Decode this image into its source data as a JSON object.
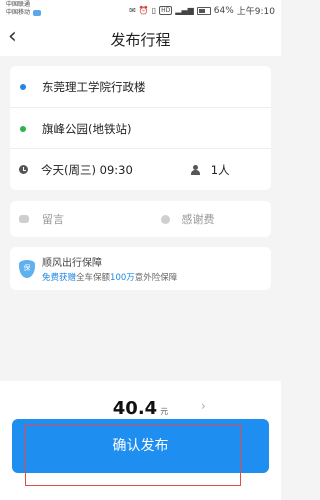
{
  "status_bar": {
    "carrier1": "中国联通",
    "carrier2": "中国移动",
    "battery": "64%",
    "time": "上午9:10",
    "hd": "HD"
  },
  "nav": {
    "back_icon": "chevron-left-icon",
    "title": "发布行程"
  },
  "route": {
    "origin": {
      "text": "东莞理工学院行政楼",
      "dot_color": "#1e88e5"
    },
    "destination": {
      "text": "旗峰公园(地铁站)",
      "dot_color": "#2eb34a"
    },
    "time": "今天(周三) 09:30",
    "passengers": "1人"
  },
  "extras": {
    "message_placeholder": "留言",
    "thanks_placeholder": "感谢费"
  },
  "insurance": {
    "title": "顺风出行保障",
    "desc_prefix": "免费获赠",
    "desc_amount": "100万",
    "desc_suffix": "全车保额",
    "desc_tail": "意外险保障",
    "badge": "保"
  },
  "price": {
    "value": "40.4",
    "unit": "元"
  },
  "confirm_button": "确认发布",
  "colors": {
    "accent": "#1e8ef0",
    "outline": "#e04a4a"
  }
}
